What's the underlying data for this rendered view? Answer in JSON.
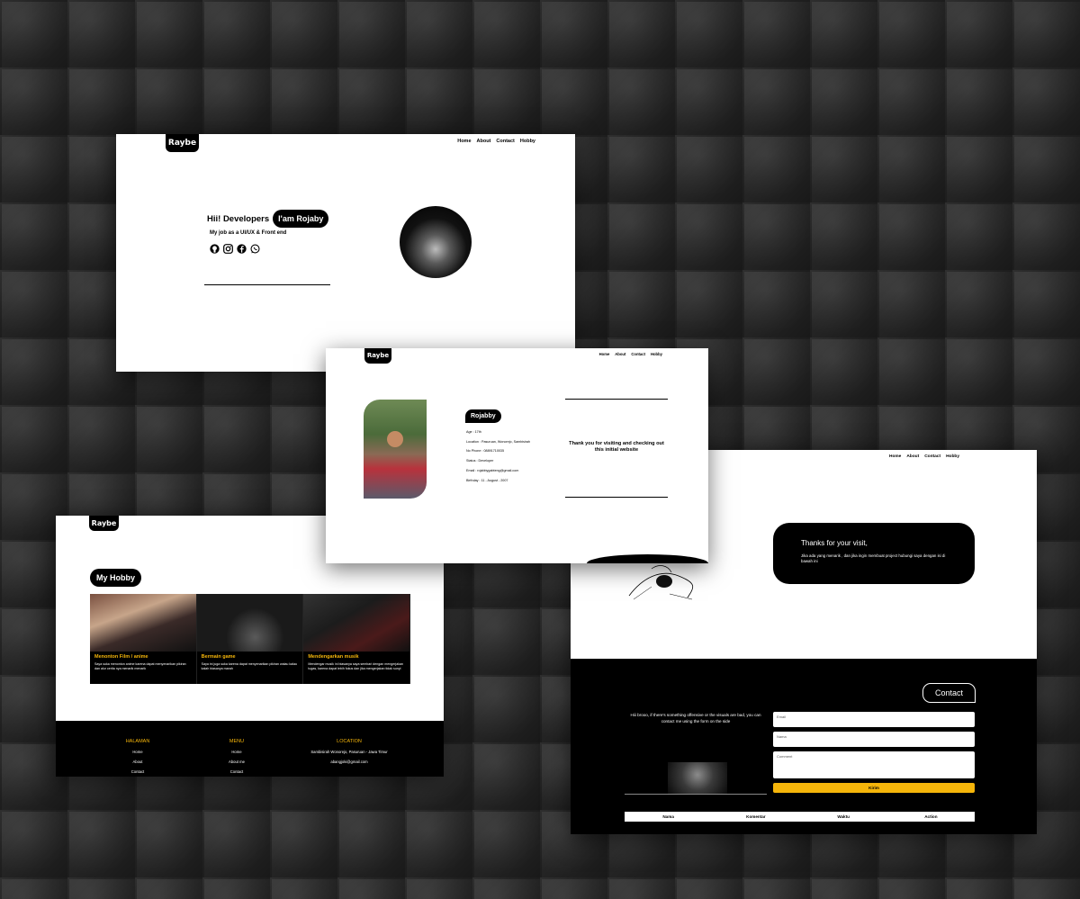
{
  "brand": "Raybe",
  "nav": [
    "Home",
    "About",
    "Contact",
    "Hobby"
  ],
  "home": {
    "greeting": "Hii! Developers",
    "name_pill": "I'am Rojaby",
    "job": "My job as a UI/UX & Front end",
    "socials": [
      "github-icon",
      "instagram-icon",
      "facebook-icon",
      "whatsapp-icon"
    ]
  },
  "about": {
    "name": "Rojabby",
    "info": [
      "Age : 17th",
      "Location : Pasuruan, Wonorejo, Sambisirah",
      "No Phone : 08891710035",
      "Status : Developer",
      "Email : rojabbygabteng@gmail.com",
      "Birthday : 11 - August - 2007"
    ],
    "thanks": "Thank you for visiting and checking out this initial website"
  },
  "hobby": {
    "title": "My Hobby",
    "cards": [
      {
        "title": "Menonton Film / anime",
        "desc": "Saya suka menonton anime karena dapat menyenarikan pikiran dan alur cerita nya menarik menarik"
      },
      {
        "title": "Bermain game",
        "desc": "Saya ini juga suka karena dapat menyenarikan pikiran walau kalau kalah biasanya marah"
      },
      {
        "title": "Mendengarkan musik",
        "desc": "Mendengar musik ini biasanya saya sembari dengan mengerjakan tugas, karena dapat lebih fokus dan jika mengerjakan tidak sunyi"
      }
    ],
    "footer": {
      "col1": {
        "head": "HALAMAN",
        "items": [
          "Home",
          "About",
          "Contact"
        ]
      },
      "col2": {
        "head": "MENU",
        "items": [
          "Home",
          "About me",
          "Contact"
        ]
      },
      "col3": {
        "head": "LOCATION",
        "items": [
          "Sambisirah Wonorejo, Pasuruan - Jawa Timur",
          "abangjoki@gmail.com"
        ]
      }
    }
  },
  "contact": {
    "thanks_title": "Thanks for your visit,",
    "thanks_body": "Jika ada yang menarik , dan jika ingin membuat project hubungi saya dengan isi di bawah ini",
    "button": "Contact",
    "hint": "Hiii brooo, if there's something offensive or the visuals are bad, you can contact me using the form on the side",
    "email_placeholder": "Email",
    "name_placeholder": "Nama",
    "comment_placeholder": "Comment",
    "send": "Kirim",
    "table_headers": [
      "Nama",
      "Komentar",
      "Waktu",
      "Action"
    ]
  },
  "colors": {
    "accent": "#f5b50a",
    "dark": "#000000",
    "light": "#ffffff"
  }
}
